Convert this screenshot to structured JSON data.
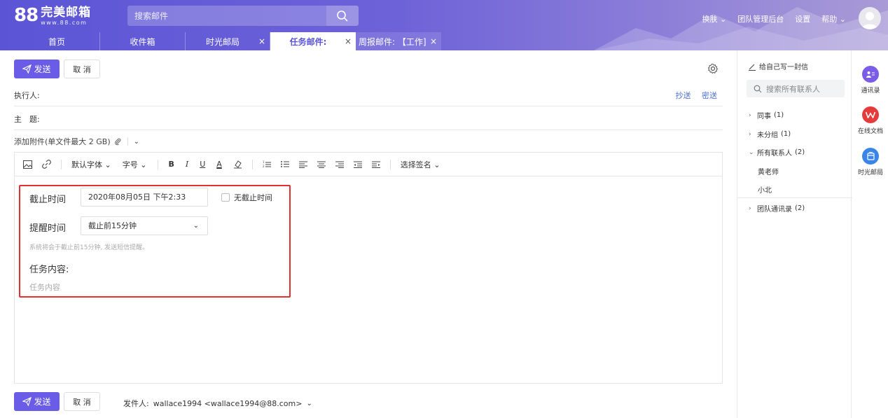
{
  "header": {
    "logo_number": "88",
    "logo_text": "完美邮箱",
    "logo_url": "www.88.com",
    "search_placeholder": "搜索邮件",
    "nav": [
      "换肤",
      "团队管理后台",
      "设置",
      "帮助"
    ]
  },
  "tabs": [
    {
      "label": "首页",
      "closable": false
    },
    {
      "label": "收件箱",
      "closable": false
    },
    {
      "label": "时光邮局",
      "closable": true
    },
    {
      "label": "任务邮件:",
      "closable": true,
      "active": true
    },
    {
      "label": "周报邮件: 【工作]",
      "closable": true
    }
  ],
  "compose": {
    "send_label": "发送",
    "cancel_label": "取 消",
    "executor_label": "执行人:",
    "cc_label": "抄送",
    "bcc_label": "密送",
    "subject_label": "主　题:",
    "attach_label": "添加附件(单文件最大 2 GB)",
    "toolbar": {
      "font_label": "默认字体",
      "size_label": "字号",
      "bold": "B",
      "italic": "I",
      "underline": "U",
      "font_color": "A",
      "signature_label": "选择签名"
    },
    "task": {
      "deadline_label": "截止时间",
      "deadline_value": "2020年08月05日 下午2:33",
      "no_deadline_label": "无截止时间",
      "remind_label": "提醒时间",
      "remind_value": "截止前15分钟",
      "hint": "系统将会于截止前15分钟, 发送短信提醒。",
      "content_label": "任务内容:",
      "content_placeholder": "任务内容"
    },
    "from_label": "发件人:",
    "from_value": "wallace1994 <wallace1994@88.com>"
  },
  "contacts": {
    "self_write": "给自己写一封信",
    "search_placeholder": "搜索所有联系人",
    "groups": [
      {
        "label": "同事",
        "count": "(1)",
        "expanded": false
      },
      {
        "label": "未分组",
        "count": "(1)",
        "expanded": false
      },
      {
        "label": "所有联系人",
        "count": "(2)",
        "expanded": true,
        "members": [
          "黄老师",
          "小北"
        ]
      },
      {
        "label": "团队通讯录",
        "count": "(2)",
        "expanded": false
      }
    ]
  },
  "side_apps": [
    {
      "label": "通讯录",
      "icon": "contacts-icon",
      "color": "#7a5ce6"
    },
    {
      "label": "在线文档",
      "icon": "wps-icon",
      "color": "#e53b3b"
    },
    {
      "label": "时光邮局",
      "icon": "mailbox-icon",
      "color": "#3a86e8"
    }
  ],
  "colors": {
    "accent": "#6a5ce6",
    "link": "#4a6fd8",
    "highlight_border": "#e53030"
  }
}
